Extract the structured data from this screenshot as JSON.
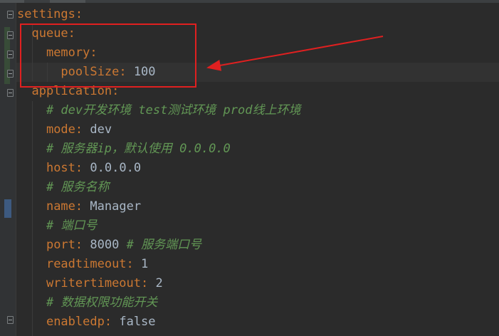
{
  "editor": {
    "lines": [
      {
        "indent": "",
        "key": "settings",
        "colon": ":",
        "sep": "",
        "value": "",
        "comment": ""
      },
      {
        "indent": "  ",
        "key": "queue",
        "colon": ":",
        "sep": "",
        "value": "",
        "comment": ""
      },
      {
        "indent": "    ",
        "key": "memory",
        "colon": ":",
        "sep": "",
        "value": "",
        "comment": ""
      },
      {
        "indent": "      ",
        "key": "poolSize",
        "colon": ":",
        "sep": " ",
        "value": "100",
        "comment": ""
      },
      {
        "indent": "  ",
        "key": "application",
        "colon": ":",
        "sep": "",
        "value": "",
        "comment": ""
      },
      {
        "indent": "    ",
        "key": "",
        "colon": "",
        "sep": "",
        "value": "",
        "comment": "# dev开发环境 test测试环境 prod线上环境"
      },
      {
        "indent": "    ",
        "key": "mode",
        "colon": ":",
        "sep": " ",
        "value": "dev",
        "comment": ""
      },
      {
        "indent": "    ",
        "key": "",
        "colon": "",
        "sep": "",
        "value": "",
        "comment": "# 服务器ip，默认使用 0.0.0.0"
      },
      {
        "indent": "    ",
        "key": "host",
        "colon": ":",
        "sep": " ",
        "value": "0.0.0.0",
        "comment": ""
      },
      {
        "indent": "    ",
        "key": "",
        "colon": "",
        "sep": "",
        "value": "",
        "comment": "# 服务名称"
      },
      {
        "indent": "    ",
        "key": "name",
        "colon": ":",
        "sep": " ",
        "value": "Manager",
        "comment": ""
      },
      {
        "indent": "    ",
        "key": "",
        "colon": "",
        "sep": "",
        "value": "",
        "comment": "# 端口号"
      },
      {
        "indent": "    ",
        "key": "port",
        "colon": ":",
        "sep": " ",
        "value": "8000 ",
        "comment": "# 服务端口号"
      },
      {
        "indent": "    ",
        "key": "readtimeout",
        "colon": ":",
        "sep": " ",
        "value": "1",
        "comment": ""
      },
      {
        "indent": "    ",
        "key": "writertimeout",
        "colon": ":",
        "sep": " ",
        "value": "2",
        "comment": ""
      },
      {
        "indent": "    ",
        "key": "",
        "colon": "",
        "sep": "",
        "value": "",
        "comment": "# 数据权限功能开关"
      },
      {
        "indent": "    ",
        "key": "enabledp",
        "colon": ":",
        "sep": " ",
        "value": "false",
        "comment": ""
      }
    ]
  },
  "colors": {
    "background": "#2b2b2b",
    "key": "#cc7832",
    "value": "#a9b7c6",
    "comment": "#629755",
    "annotation": "#e02020"
  },
  "annotations": {
    "highlight_box": "red-rectangle-around-queue-block",
    "arrow": "red-arrow-pointing-to-poolSize"
  }
}
